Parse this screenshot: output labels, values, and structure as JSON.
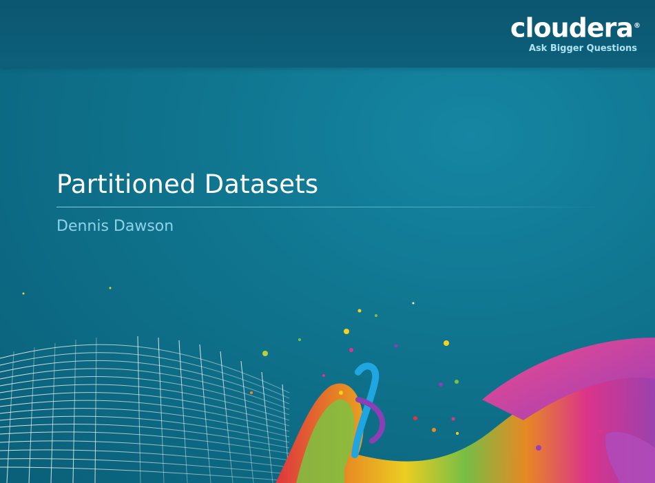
{
  "brand": {
    "logo_wordmark": "cloudera",
    "logo_mark": "®",
    "tagline": "Ask Bigger Questions"
  },
  "slide": {
    "title": "Partitioned Datasets",
    "subtitle": "Dennis Dawson"
  },
  "colors": {
    "background": "#10758f",
    "header": "#0b5670",
    "title": "#ffffff",
    "subtitle": "#8fd3ea",
    "tagline": "#aee3f2"
  }
}
